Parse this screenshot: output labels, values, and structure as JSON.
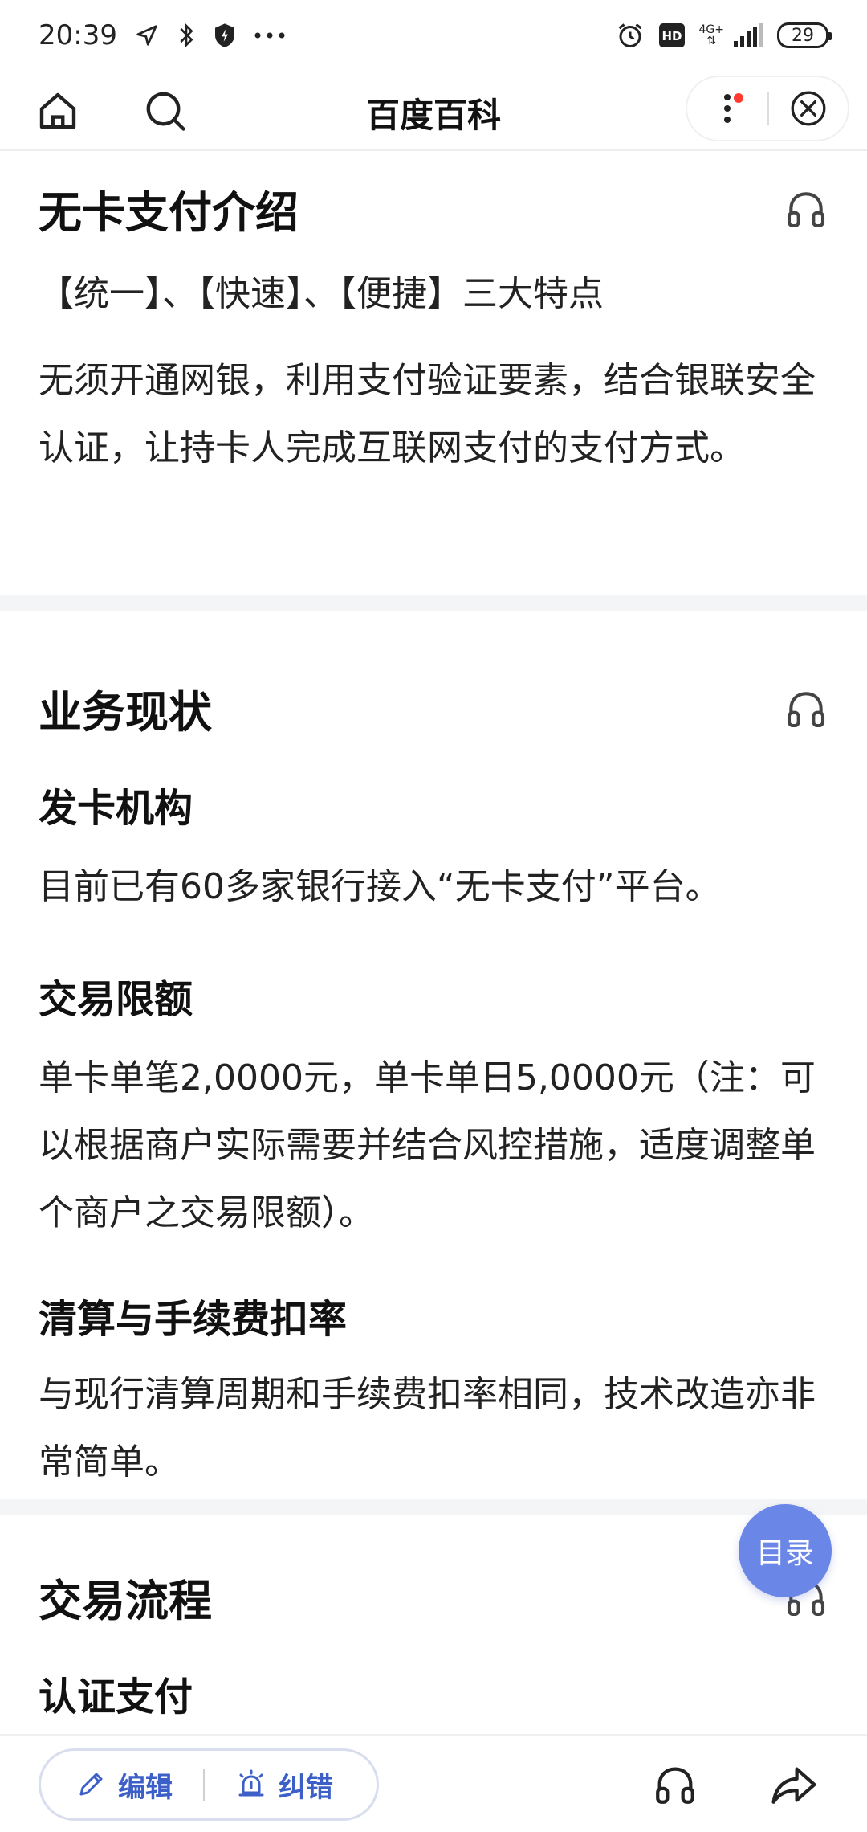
{
  "status_bar": {
    "time": "20:39",
    "network_top": "4G+",
    "network_bottom": "⇅",
    "hd_label": "HD",
    "battery": "29"
  },
  "nav": {
    "title": "百度百科"
  },
  "sections": {
    "intro": {
      "title": "无卡支付介绍",
      "features": "【统一】、【快速】、【便捷】三大特点",
      "body": "无须开通网银，利用支付验证要素，结合银联安全认证，让持卡人完成互联网支付的支付方式。"
    },
    "status": {
      "title": "业务现状",
      "issuers_title": "发卡机构",
      "issuers_body": "目前已有60多家银行接入“无卡支付”平台。",
      "limits_title": "交易限额",
      "limits_body": "单卡单笔2,0000元，单卡单日5,0000元（注：可以根据商户实际需要并结合风控措施，适度调整单个商户之交易限额）。",
      "settlement_title": "清算与手续费扣率",
      "settlement_body": "与现行清算周期和手续费扣率相同，技术改造亦非常简单。"
    },
    "flow": {
      "title": "交易流程",
      "auth_title": "认证支付"
    }
  },
  "toc_label": "目录",
  "bottom_bar": {
    "edit_label": "编辑",
    "report_label": "纠错"
  },
  "colors": {
    "accent": "#3d5fc8",
    "toc_bg": "#6a86e6",
    "red_dot": "#ff3b30"
  },
  "icons": [
    "home-icon",
    "search-icon",
    "more-icon",
    "close-icon",
    "headphones-icon",
    "pencil-icon",
    "error-report-icon",
    "share-icon",
    "location-arrow-icon",
    "bluetooth-icon",
    "shield-icon",
    "alarm-icon",
    "signal-icon"
  ]
}
